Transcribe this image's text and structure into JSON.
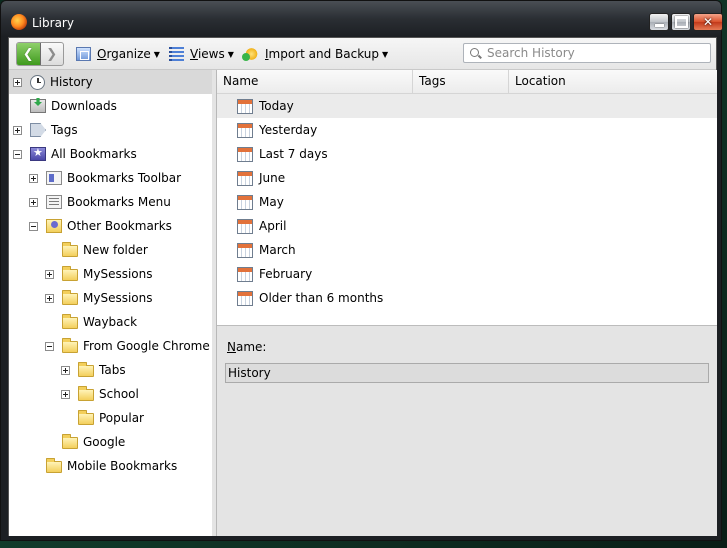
{
  "window": {
    "title": "Library",
    "buttons": {
      "minimize": "minimize",
      "maximize": "maximize",
      "close": "✕"
    }
  },
  "toolbar": {
    "back": "❮",
    "forward": "❯",
    "organize": {
      "label": "Organize",
      "underline": "O",
      "rest": "rganize"
    },
    "views": {
      "label": "Views",
      "underline": "V",
      "rest": "iews"
    },
    "import": {
      "label": "Import and Backup",
      "underline": "I",
      "rest": "mport and Backup"
    },
    "search_placeholder": "Search History"
  },
  "sidebar": {
    "items": [
      {
        "label": "History",
        "icon": "clock-icon",
        "toggle": "plus",
        "selected": true
      },
      {
        "label": "Downloads",
        "icon": "download-icon",
        "toggle": "none"
      },
      {
        "label": "Tags",
        "icon": "tag-icon",
        "toggle": "plus"
      },
      {
        "label": "All Bookmarks",
        "icon": "all-bookmarks-icon",
        "toggle": "minus"
      },
      {
        "label": "Bookmarks Toolbar",
        "icon": "bookmarks-toolbar-icon",
        "toggle": "plus"
      },
      {
        "label": "Bookmarks Menu",
        "icon": "bookmarks-menu-icon",
        "toggle": "plus"
      },
      {
        "label": "Other Bookmarks",
        "icon": "other-bookmarks-icon",
        "toggle": "minus"
      },
      {
        "label": "New folder",
        "icon": "folder-icon",
        "toggle": "none"
      },
      {
        "label": "MySessions",
        "icon": "folder-icon",
        "toggle": "plus"
      },
      {
        "label": "MySessions",
        "icon": "folder-icon",
        "toggle": "plus"
      },
      {
        "label": "Wayback",
        "icon": "folder-icon",
        "toggle": "none"
      },
      {
        "label": "From Google Chrome",
        "icon": "folder-icon",
        "toggle": "minus"
      },
      {
        "label": "Tabs",
        "icon": "folder-icon",
        "toggle": "plus"
      },
      {
        "label": "School",
        "icon": "folder-icon",
        "toggle": "plus"
      },
      {
        "label": "Popular",
        "icon": "folder-icon",
        "toggle": "none"
      },
      {
        "label": "Google",
        "icon": "folder-icon",
        "toggle": "none"
      },
      {
        "label": "Mobile Bookmarks",
        "icon": "folder-icon",
        "toggle": "none"
      }
    ]
  },
  "list": {
    "columns": [
      "Name",
      "Tags",
      "Location"
    ],
    "rows": [
      {
        "name": "Today",
        "selected": true
      },
      {
        "name": "Yesterday"
      },
      {
        "name": "Last 7 days"
      },
      {
        "name": "June"
      },
      {
        "name": "May"
      },
      {
        "name": "April"
      },
      {
        "name": "March"
      },
      {
        "name": "February"
      },
      {
        "name": "Older than 6 months"
      }
    ]
  },
  "details": {
    "name_label_underline": "N",
    "name_label_rest": "ame:",
    "name_value": "History"
  }
}
